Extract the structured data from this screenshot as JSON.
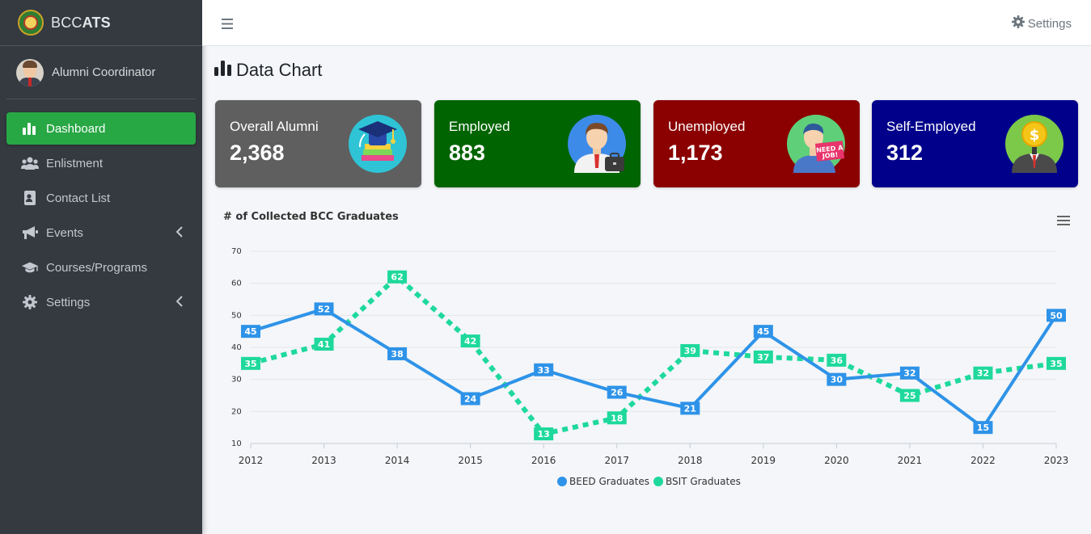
{
  "brand": {
    "prefix": "BCC",
    "suffix": "ATS"
  },
  "user": {
    "name": "Alumni Coordinator"
  },
  "sidebar": {
    "items": [
      {
        "label": "Dashboard",
        "icon": "chart-bar-icon",
        "active": true
      },
      {
        "label": "Enlistment",
        "icon": "users-icon"
      },
      {
        "label": "Contact List",
        "icon": "address-card-icon"
      },
      {
        "label": "Events",
        "icon": "bullhorn-icon",
        "has_submenu": true
      },
      {
        "label": "Courses/Programs",
        "icon": "graduation-cap-icon"
      },
      {
        "label": "Settings",
        "icon": "gear-icon",
        "has_submenu": true
      }
    ]
  },
  "header": {
    "settings_label": "Settings"
  },
  "page": {
    "title": "Data Chart"
  },
  "cards": [
    {
      "label": "Overall Alumni",
      "value": "2,368",
      "color": "#5f5f5f"
    },
    {
      "label": "Employed",
      "value": "883",
      "color": "#006400"
    },
    {
      "label": "Unemployed",
      "value": "1,173",
      "color": "#8b0000"
    },
    {
      "label": "Self-Employed",
      "value": "312",
      "color": "#00008b"
    }
  ],
  "chart_data": {
    "type": "line",
    "title": "# of Collected BCC Graduates",
    "x": [
      "2012",
      "2013",
      "2014",
      "2015",
      "2016",
      "2017",
      "2018",
      "2019",
      "2020",
      "2021",
      "2022",
      "2023"
    ],
    "ylim": [
      10,
      70
    ],
    "yticks": [
      10,
      20,
      30,
      40,
      50,
      60,
      70
    ],
    "grid": true,
    "legend": "bottom-center",
    "series": [
      {
        "name": "BEED Graduates",
        "color": "#2e93e8",
        "style": "solid",
        "values": [
          45,
          52,
          38,
          24,
          33,
          26,
          21,
          45,
          30,
          32,
          15,
          50
        ]
      },
      {
        "name": "BSIT Graduates",
        "color": "#1ed99b",
        "style": "dotted",
        "values": [
          35,
          41,
          62,
          42,
          13,
          18,
          39,
          37,
          36,
          25,
          32,
          35
        ]
      }
    ]
  },
  "colors": {
    "sidebar": "#343a40",
    "active": "#28a745"
  }
}
